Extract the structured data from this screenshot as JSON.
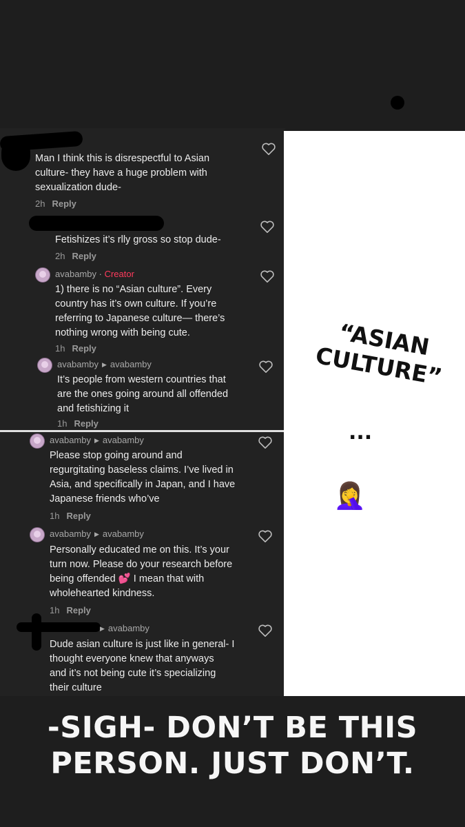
{
  "comments": [
    {
      "user": "",
      "text_lines": [
        "Man I think this is disrespectful to Asian",
        "culture- they have a huge problem with",
        "sexualization dude-"
      ],
      "time": "2h",
      "reply": "Reply"
    },
    {
      "user": "",
      "text_lines": [
        "Fetishizes it’s rlly gross so stop dude-"
      ],
      "time": "2h",
      "reply": "Reply"
    },
    {
      "user": "avabamby",
      "creator_badge": "Creator",
      "separator": "·",
      "text_lines": [
        "1) there is no “Asian culture”. Every",
        "country has it’s own culture. If you’re",
        "referring to Japanese culture— there’s",
        "nothing wrong with being cute."
      ],
      "time": "1h",
      "reply": "Reply"
    },
    {
      "user": "avabamby",
      "reply_to": "avabamby",
      "text_lines": [
        "It’s people from western countries that",
        "are the ones going around all offended",
        "and fetishizing it"
      ],
      "time": "1h",
      "reply": "Reply"
    },
    {
      "user": "avabamby",
      "reply_to": "avabamby",
      "text_lines": [
        "Please stop going around and",
        "regurgitating baseless claims. I’ve lived in",
        "Asia, and specifically in Japan, and I have",
        "Japanese friends who’ve"
      ],
      "time": "1h",
      "reply": "Reply"
    },
    {
      "user": "avabamby",
      "reply_to": "avabamby",
      "text_lines": [
        "Personally educated me on this. It’s your",
        "turn now. Please do your research before",
        "being offended 💕  I mean that with",
        "wholehearted kindness."
      ],
      "time": "1h",
      "reply": "Reply"
    },
    {
      "user": "",
      "reply_to": "avabamby",
      "text_lines": [
        "Dude asian culture is just like in general- I",
        "thought everyone knew that anyways",
        "and it’s not being cute it’s specializing",
        "their culture"
      ]
    }
  ],
  "overlay": {
    "quote_line1": "“ASIAN",
    "quote_line2": "CULTURE”",
    "ellipsis": "...",
    "facepalm": "🤦‍♀️",
    "caption_line1": "-SIGH- DON’T BE THIS",
    "caption_line2": "PERSON. JUST DON’T."
  },
  "icons": {
    "like": "heart-outline-icon",
    "reply_arrow": "triangle-right-icon"
  }
}
